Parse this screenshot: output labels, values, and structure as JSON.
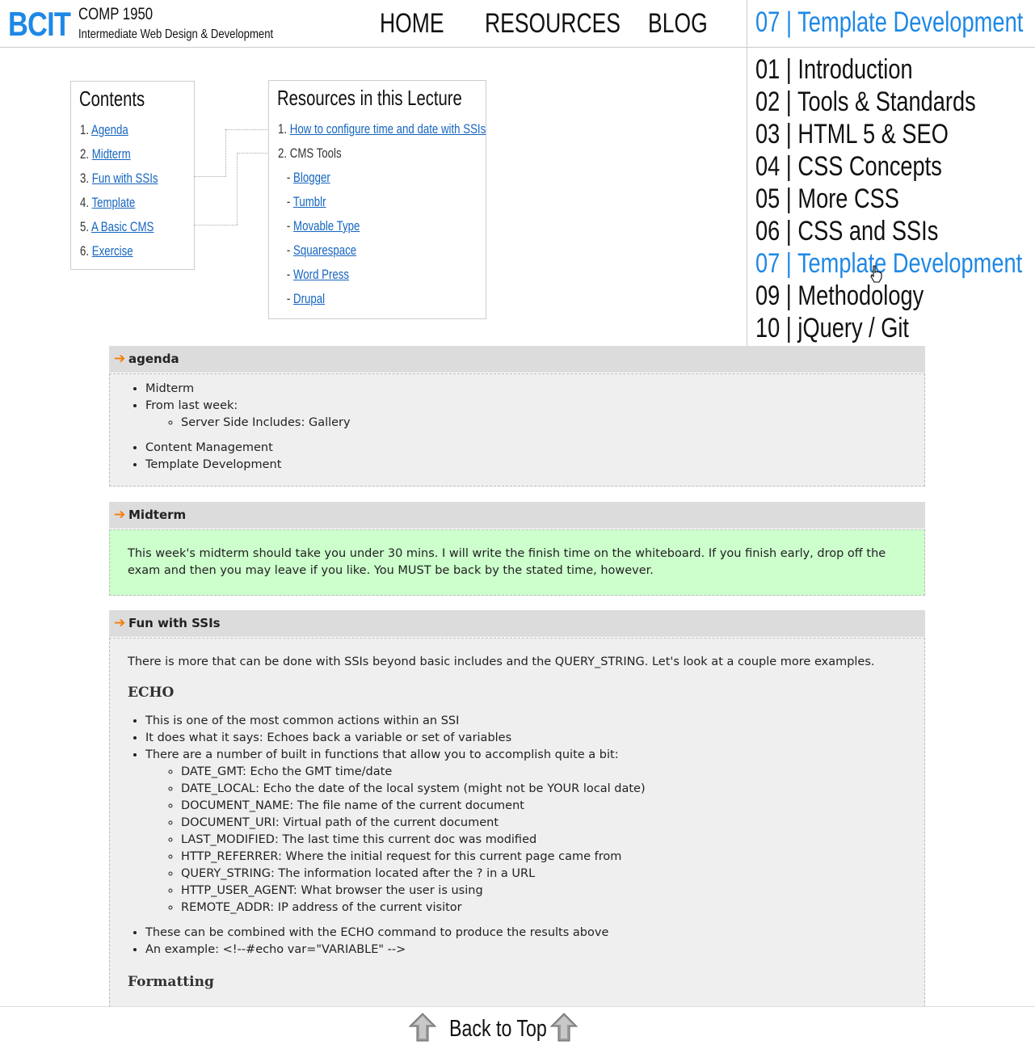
{
  "header": {
    "logo": "BCIT",
    "course_code": "COMP 1950",
    "course_title": "Intermediate Web Design & Development",
    "nav": [
      "HOME",
      "RESOURCES",
      "BLOG"
    ]
  },
  "lectures": {
    "current": "07 | Template Development",
    "items": [
      "01  | Introduction",
      "02 | Tools & Standards",
      "03 | HTML 5 & SEO",
      "04 | CSS Concepts",
      "05 | More CSS",
      "06 | CSS and SSIs",
      "07 | Template Development",
      "09 | Methodology",
      "10  | jQuery / Git"
    ]
  },
  "contents": {
    "title": "Contents",
    "items": [
      "Agenda",
      "Midterm",
      "Fun with SSIs",
      "Template",
      "A Basic CMS",
      "Exercise"
    ]
  },
  "resources": {
    "title": "Resources in this Lecture",
    "item1_link": "How to configure time and date with SSIs",
    "item2_label": "CMS Tools",
    "cms_tools": [
      "Blogger",
      "Tumblr",
      "Movable Type",
      "Squarespace",
      "Word Press",
      "Drupal"
    ]
  },
  "agenda": {
    "title": "agenda",
    "items": [
      "Midterm",
      "From last week:",
      "Content Management",
      "Template Development"
    ],
    "sub_items": [
      "Server Side Includes: Gallery"
    ]
  },
  "midterm": {
    "title": "Midterm",
    "text": "This week's midterm should take you under 30 mins. I will write the finish time on the whiteboard. If you finish early, drop off the exam and then you may leave if you like. You MUST be back by the stated time, however."
  },
  "ssi": {
    "title": "Fun with SSIs",
    "intro": "There is more that can be done with SSIs beyond basic includes and the QUERY_STRING. Let's look at a couple more examples.",
    "echo_heading": "ECHO",
    "echo_items": [
      "This is one of the most common actions within an SSI",
      "It does what it says: Echoes back a variable or set of variables",
      "There are a number of built in functions that allow you to accomplish quite a bit:"
    ],
    "functions": [
      "DATE_GMT: Echo the GMT time/date",
      "DATE_LOCAL: Echo the date of the local system (might not be YOUR local date)",
      "DOCUMENT_NAME: The file name of the current document",
      "DOCUMENT_URI: Virtual path of the current document",
      "LAST_MODIFIED: The last time this current doc was modified",
      "HTTP_REFERRER: Where the initial request for this current page came from",
      "QUERY_STRING: The information located after the ? in a URL",
      "HTTP_USER_AGENT: What browser the user is using",
      "REMOTE_ADDR: IP address of the current visitor"
    ],
    "after_items": [
      "These can be combined with the ECHO command to produce the results above",
      "An example: <!--#echo var=\"VARIABLE\" -->"
    ],
    "formatting_heading": "Formatting"
  },
  "footer": {
    "back_to_top": "Back to Top"
  },
  "colors": {
    "accent": "#1e88e5",
    "arrow": "#f57c00",
    "midterm_bg": "#ccffcc",
    "section_head": "#dcdcdc"
  }
}
